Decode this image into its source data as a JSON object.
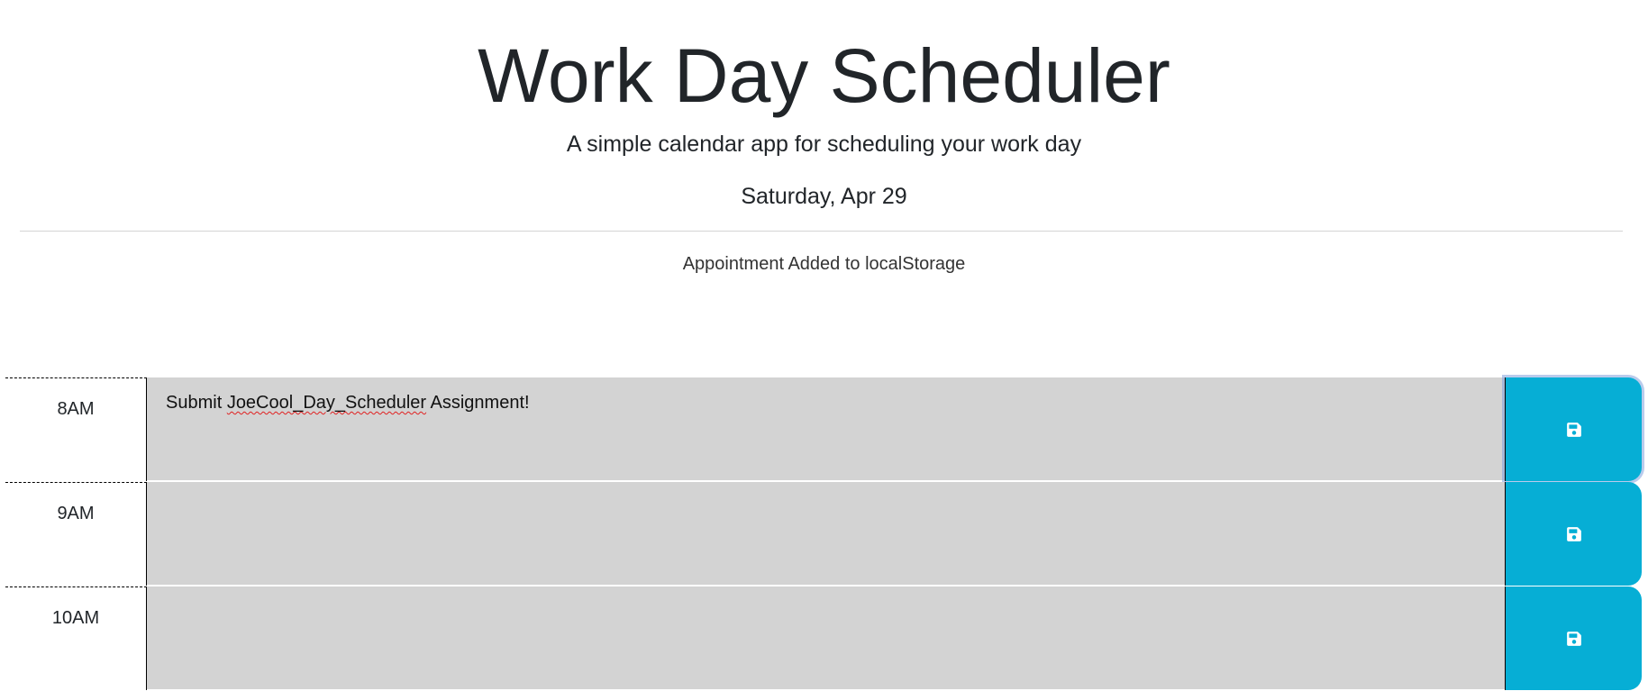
{
  "header": {
    "title": "Work Day Scheduler",
    "lead": "A simple calendar app for scheduling your work day",
    "current_day": "Saturday, Apr 29",
    "notice": "Appointment Added to localStorage"
  },
  "colors": {
    "save_button": "#06aed5",
    "past_block": "#d3d3d3"
  },
  "time_blocks": [
    {
      "hour": "8AM",
      "text_before": "Submit ",
      "text_misspelled": "JoeCool_Day_Scheduler",
      "text_after": " Assignment!",
      "save_icon": "floppy-disk-icon"
    },
    {
      "hour": "9AM",
      "text_before": "",
      "text_misspelled": "",
      "text_after": "",
      "save_icon": "floppy-disk-icon"
    },
    {
      "hour": "10AM",
      "text_before": "",
      "text_misspelled": "",
      "text_after": "",
      "save_icon": "floppy-disk-icon"
    }
  ]
}
